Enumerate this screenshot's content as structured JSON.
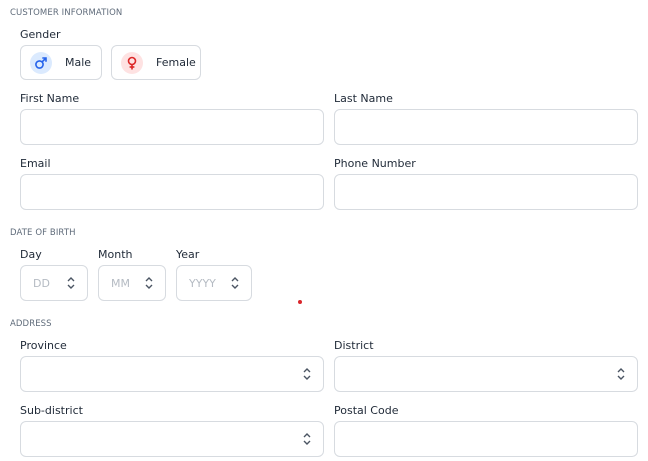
{
  "customer": {
    "section_title": "CUSTOMER INFORMATION",
    "gender_label": "Gender",
    "gender_options": [
      {
        "label": "Male",
        "icon": "male-icon",
        "color": "#2563eb",
        "bg": "#dbeafe"
      },
      {
        "label": "Female",
        "icon": "female-icon",
        "color": "#dc2626",
        "bg": "#fee2e2"
      }
    ],
    "first_name_label": "First Name",
    "last_name_label": "Last Name",
    "email_label": "Email",
    "phone_label": "Phone Number"
  },
  "dob": {
    "section_title": "DATE OF BIRTH",
    "day_label": "Day",
    "day_placeholder": "DD",
    "month_label": "Month",
    "month_placeholder": "MM",
    "year_label": "Year",
    "year_placeholder": "YYYY"
  },
  "address": {
    "section_title": "ADDRESS",
    "province_label": "Province",
    "district_label": "District",
    "subdistrict_label": "Sub-district",
    "postal_label": "Postal Code"
  }
}
